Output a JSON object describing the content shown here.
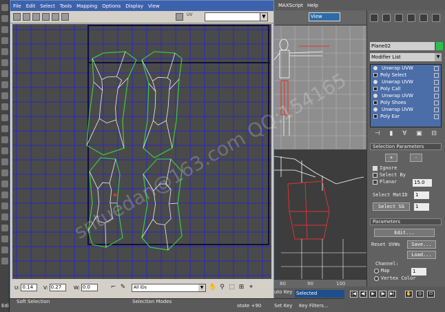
{
  "uv_editor": {
    "menus": [
      "File",
      "Edit",
      "Select",
      "Tools",
      "Mapping",
      "Options",
      "Display",
      "View"
    ],
    "map_logo": "UV",
    "coords": {
      "u_label": "U:",
      "u": "0.14",
      "v_label": "V:",
      "v": "0.27",
      "w_label": "W:",
      "w": "0.0"
    },
    "id_filter": "All IDs"
  },
  "max": {
    "menus": [
      "MAXScript",
      "Help"
    ],
    "viewport_select": "View"
  },
  "command_panel": {
    "object_name": "Plane02",
    "object_color": "#29c14b",
    "modifier_list": "Modifier List",
    "stack": [
      {
        "label": "Unwrap UVW",
        "type": "bulb"
      },
      {
        "label": "Poly Select",
        "type": "box"
      },
      {
        "label": "Unwrap UVW",
        "type": "bulb"
      },
      {
        "label": "Poly Call",
        "type": "box"
      },
      {
        "label": "Unwrap UVW",
        "type": "bulb"
      },
      {
        "label": "Poly Shoes",
        "type": "box"
      },
      {
        "label": "Unwrap UVW",
        "type": "bulb"
      },
      {
        "label": "Poly Ear",
        "type": "box"
      }
    ],
    "selection_params": {
      "title": "Selection Parameters",
      "plus": "+",
      "minus": "-",
      "ignore": "Ignore",
      "select_by": "Select By",
      "planar": "Planar",
      "planar_val": "15.0",
      "select_matid": "Select MatID",
      "matid_val": "1",
      "select_sg": "Select SG",
      "sg_val": "1"
    },
    "parameters": {
      "title": "Parameters",
      "edit": "Edit...",
      "reset_uvws": "Reset UVWs",
      "save": "Save...",
      "load": "Load...",
      "channel": "Channel:",
      "map": "Map",
      "map_val": "1",
      "vertex_color": "Vertex Color"
    }
  },
  "status": {
    "soft_selection": "Soft Selection",
    "selection_modes": "Selection Modes",
    "rotate": "otate +90",
    "edit": "Edi",
    "auto_key": "uto Key",
    "selected": "Selected",
    "set_key": "Set Key",
    "key_filters": "Key Filters..."
  },
  "timeline": {
    "ticks": [
      "80",
      "90",
      "100"
    ]
  },
  "watermark": "sntuedan@163.com QQ:154165"
}
